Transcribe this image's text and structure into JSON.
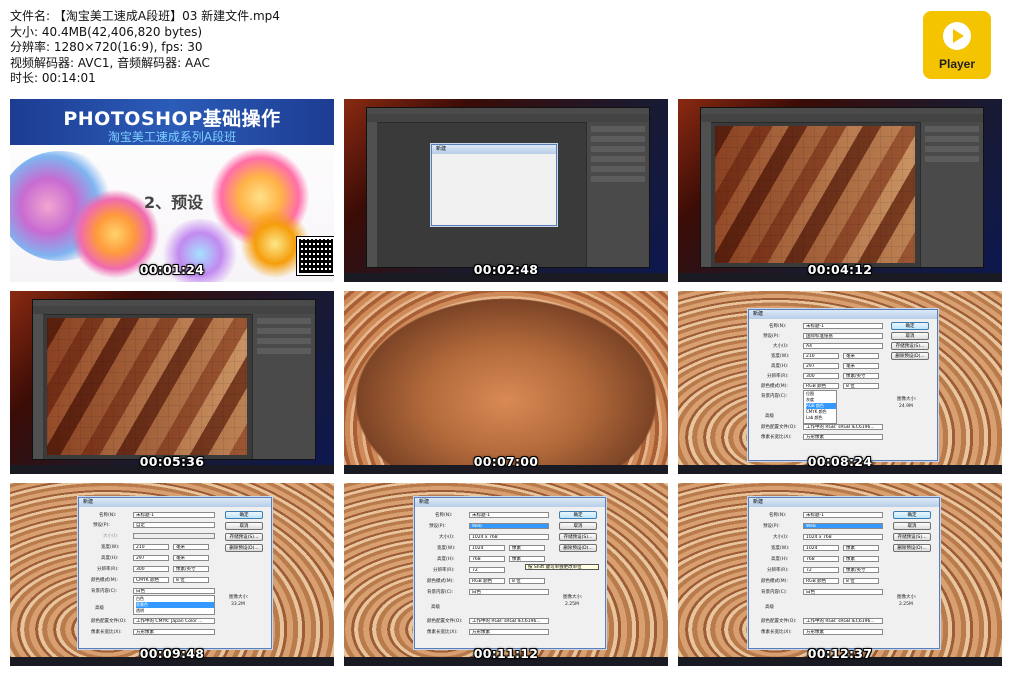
{
  "info": {
    "filename": "文件名: 【淘宝美工速成A段班】03 新建文件.mp4",
    "size": "大小: 40.4MB(42,406,820 bytes)",
    "resolution": "分辨率: 1280×720(16:9), fps: 30",
    "codec": "视频解码器: AVC1, 音频解码器: AAC",
    "duration": "时长: 00:14:01"
  },
  "logo": {
    "label": "Player",
    "color": "#f5c400",
    "icon": "play-icon"
  },
  "thumbs": [
    {
      "time": "00:01:24",
      "title": "PHOTOSHOP基础操作",
      "subtitle": "淘宝美工速成系列A段班",
      "heading": "2、预设"
    },
    {
      "time": "00:02:48"
    },
    {
      "time": "00:04:12"
    },
    {
      "time": "00:05:36"
    },
    {
      "time": "00:07:00"
    },
    {
      "time": "00:08:24"
    },
    {
      "time": "00:09:48"
    },
    {
      "time": "00:11:12"
    },
    {
      "time": "00:12:37"
    }
  ],
  "dialog": {
    "title": "新建",
    "name_label": "名称(N):",
    "name_value": "未标题-1",
    "preset_label": "预设(P):",
    "preset_a4": "国际标准纸张",
    "preset_custom": "自定",
    "preset_web": "Web",
    "size_label": "大小(I):",
    "size_a4": "A4",
    "size_web": "1024 x 768",
    "width_label": "宽度(W):",
    "height_label": "高度(H):",
    "res_label": "分辨率(R):",
    "mode_label": "颜色模式(M):",
    "bg_label": "背景内容(C):",
    "advanced": "高级",
    "profile_label": "颜色配置文件(O):",
    "aspect_label": "像素长宽比(X):",
    "ok": "确定",
    "cancel": "取消",
    "save": "存储预设(S)...",
    "delete": "删除预设(D)...",
    "imgsize_label": "图像大小:",
    "imgsize_a": "24.9M",
    "imgsize_b": "33.2M",
    "imgsize_c": "2.25M",
    "w210": "210",
    "h297": "297",
    "r300": "300",
    "w1024": "1024",
    "h768": "768",
    "r72": "72",
    "unit_mm": "毫米",
    "unit_px": "像素",
    "unit_ppi": "像素/英寸",
    "mode_rgb": "RGB 颜色",
    "mode_cmyk": "CMYK 颜色",
    "bits": "8 位",
    "bg_white": "白色",
    "profile_rgb": "工作中的 RGB: sRGB IEC6196...",
    "profile_cmyk": "工作中的 CMYK: Japan Color ...",
    "aspect_sq": "方形像素",
    "mode_options": [
      "位图",
      "灰度",
      "RGB 颜色",
      "CMYK 颜色",
      "Lab 颜色"
    ],
    "bg_options": [
      "白色",
      "背景色",
      "透明"
    ],
    "tooltip": "按 Shift 键可单独更改单位"
  }
}
